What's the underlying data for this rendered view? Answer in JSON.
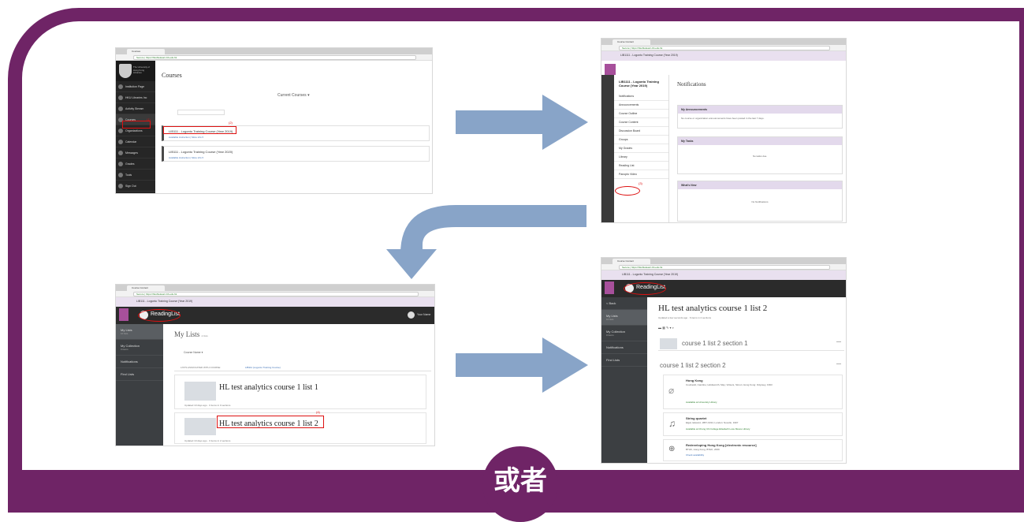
{
  "divider": {
    "or_text": "或者"
  },
  "shot1": {
    "tab": "Courses",
    "url": "Secure | https://hkuhkulearn.bb.edu.hk",
    "crest_text": "The University of Hong Kong Libraries",
    "page_title": "Courses",
    "filter_label": "Current Courses ▾",
    "side_items": [
      "Institution Page",
      "HKU Libraries Inc",
      "Activity Stream",
      "Courses",
      "Organizations",
      "Calendar",
      "Messages",
      "Grades",
      "Tools",
      "Sign Out"
    ],
    "step_num_courses": "(1)",
    "course1_title": "LIB111 - Logonto Training Course (Year 2019)",
    "course1_sub": "Available instruction | More info ▾",
    "step_num_course": "(2)",
    "course2_title": "LIB111 - Logonto Training Course (Year 2020)",
    "course2_sub": "Available instruction | More info ▾"
  },
  "shot2": {
    "tab": "Course Content",
    "url": "Secure | https://hkuhkulearn.bb.edu.hk",
    "breadcrumb": "LIB1111 - Logonto Training Course (Year 2019)",
    "course_name": "LIB1111 - Logonto Training Course (Year 2019)",
    "menu": [
      "Notifications",
      "Announcements",
      "Course Outline",
      "Course Content",
      "Discussion Board",
      "Groups",
      "My Grades",
      "Library",
      "Reading List",
      "Panopto Video"
    ],
    "step_num": "(3)",
    "heading": "Notifications",
    "modules": [
      {
        "title": "My Announcements",
        "body": "No course or organization announcements have been posted in the last 7 days."
      },
      {
        "title": "My Tasks",
        "body": "No tasks due."
      },
      {
        "title": "What's New",
        "body": "No Notifications"
      }
    ]
  },
  "shot3": {
    "tab": "Course Content",
    "url": "Secure | https://hkuhkulearn.bb.edu.hk",
    "breadcrumb": "LIB111 - Logonto Training Course (Year 2019)",
    "app_name": "ReadingList",
    "user": "Your Name",
    "side": [
      {
        "label": "My Lists",
        "sub": "10 lists"
      },
      {
        "label": "My Collection",
        "sub": "0 items"
      },
      {
        "label": "Notifications",
        "sub": ""
      },
      {
        "label": "Find Lists",
        "sub": ""
      }
    ],
    "heading": "My Lists",
    "heading_count": "4 lists",
    "filter": "Course Name ▾",
    "lists_note": "LISTS ASSOCIATED WITH COURSE:",
    "lists_link": "LIB111 (Logonto Training Course)",
    "list1_title": "HL test analytics course 1 list 1",
    "list1_meta": "Updated 10 days ago · 0 items in 0 sections",
    "step_num": "(4)",
    "list2_title": "HL test analytics course 1 list 2",
    "list2_meta": "Updated 10 days ago · 0 items in 2 sections"
  },
  "shot4": {
    "tab": "Course Content",
    "url": "Secure | https://hkuhkulearn.bb.edu.hk",
    "breadcrumb": "LIB111 - Logonto Training Course (Year 2019)",
    "app_name": "ReadingList",
    "side": [
      {
        "label": "< Back",
        "sub": ""
      },
      {
        "label": "My Lists",
        "sub": "10 lists"
      },
      {
        "label": "My Collection",
        "sub": "0 items"
      },
      {
        "label": "Notifications",
        "sub": ""
      },
      {
        "label": "Find Lists",
        "sub": ""
      }
    ],
    "title": "HL test analytics course 1 list 2",
    "meta": "Updated a few seconds ago · 6 items in 2 sections",
    "section1": "course 1 list 2 section 1",
    "section2": "course 1 list 2 section 2",
    "items": [
      {
        "title": "Hong Kong",
        "sub": "Courtauld, Caroline; Holdsworth, May; Vickers, Simon; Hong Kong: Odyssey, 1993",
        "avail": "Available at University Library"
      },
      {
        "title": "String quartet",
        "sub": "Elgar, Edward, 1857-1934; London: Novello, 1997",
        "avail": "Available at Chung Chi College Elisabeth Luce Moore Library"
      },
      {
        "title": "Redeveloping Hong Kong [electronic resource]",
        "sub": "BTHK, Hong Kong, BTHK, 2009",
        "avail": "Check availability"
      }
    ]
  }
}
